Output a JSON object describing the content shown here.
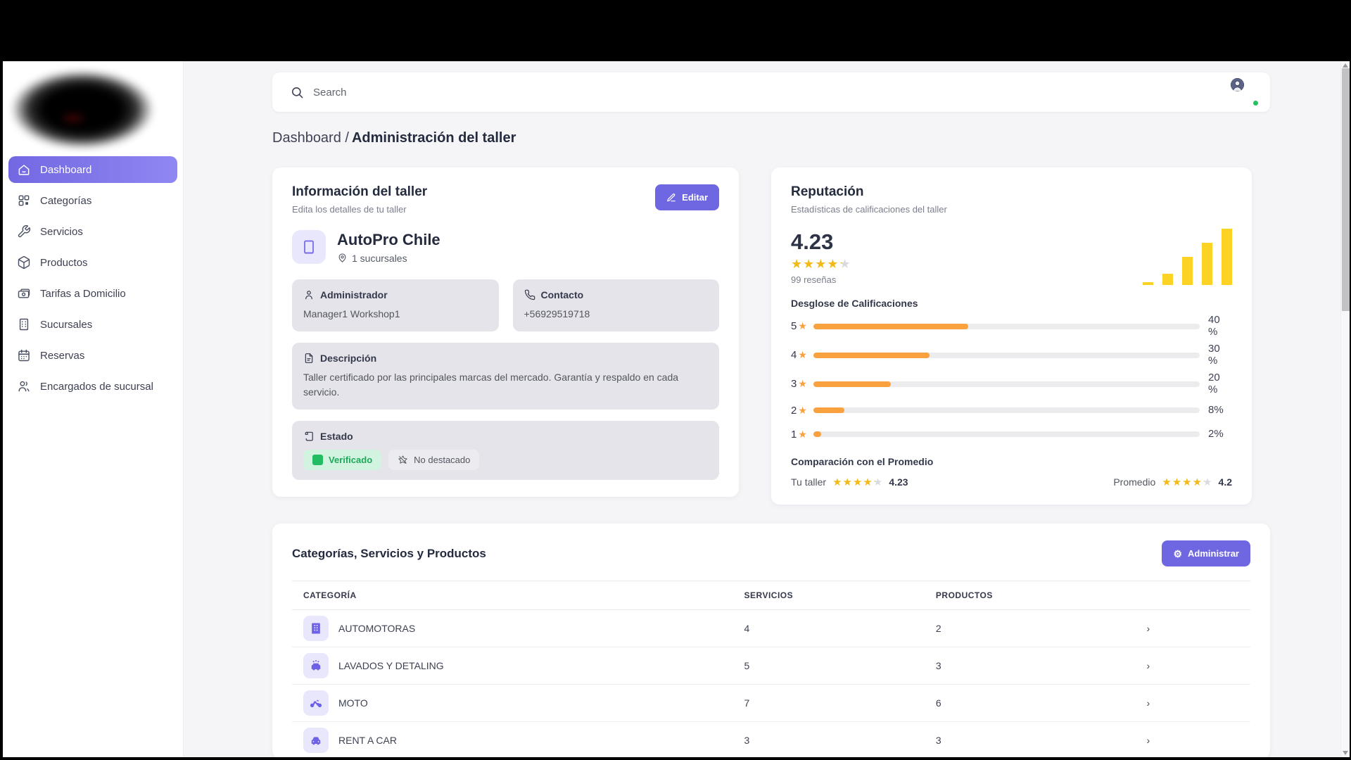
{
  "colors": {
    "accent": "#6f66e2",
    "gold": "#f3ba17",
    "bar_yellow": "#fcd325",
    "orange": "#f9a03f",
    "green": "#22bd63"
  },
  "topbar": {
    "search_placeholder": "Search"
  },
  "breadcrumb": {
    "parent": "Dashboard /",
    "current": "Administración del taller"
  },
  "sidebar": {
    "items": [
      {
        "label": "Dashboard",
        "active": true
      },
      {
        "label": "Categorías"
      },
      {
        "label": "Servicios"
      },
      {
        "label": "Productos"
      },
      {
        "label": "Tarifas a Domicilio"
      },
      {
        "label": "Sucursales"
      },
      {
        "label": "Reservas"
      },
      {
        "label": "Encargados de sucursal"
      }
    ]
  },
  "workshop_card": {
    "title": "Información del taller",
    "subtitle": "Edita los detalles de tu taller",
    "edit_button": "Editar",
    "name": "AutoPro Chile",
    "branches": "1 sucursales",
    "admin_label": "Administrador",
    "admin_value": "Manager1 Workshop1",
    "contact_label": "Contacto",
    "contact_value": "+56929519718",
    "description_label": "Descripción",
    "description_text": "Taller certificado por las principales marcas del mercado. Garantía y respaldo en cada servicio.",
    "status_label": "Estado",
    "verified_badge": "Verificado",
    "not_featured_badge": "No destacado"
  },
  "reputation_card": {
    "title": "Reputación",
    "subtitle": "Estadísticas de calificaciones del taller",
    "rating": "4.23",
    "rating_value": 4.23,
    "reviews": "99 reseñas",
    "mini_bars": [
      2,
      8,
      20,
      30,
      40
    ],
    "breakdown_title": "Desglose de Calificaciones",
    "breakdown": [
      {
        "stars": "5",
        "pct": 40,
        "label": "40 %"
      },
      {
        "stars": "4",
        "pct": 30,
        "label": "30 %"
      },
      {
        "stars": "3",
        "pct": 20,
        "label": "20 %"
      },
      {
        "stars": "2",
        "pct": 8,
        "label": "8%"
      },
      {
        "stars": "1",
        "pct": 2,
        "label": "2%"
      }
    ],
    "comparison_title": "Comparación con el Promedio",
    "your_label": "Tu taller",
    "your_value": "4.23",
    "your_rating": 4.23,
    "avg_label": "Promedio",
    "avg_value": "4.2",
    "avg_rating": 4.2
  },
  "catalog_card": {
    "title": "Categorías, Servicios y Productos",
    "manage_button": "Administrar",
    "columns": {
      "category": "CATEGORÍA",
      "services": "SERVICIOS",
      "products": "PRODUCTOS"
    },
    "rows": [
      {
        "name": "AUTOMOTORAS",
        "services": "4",
        "products": "2"
      },
      {
        "name": "LAVADOS Y DETALING",
        "services": "5",
        "products": "3"
      },
      {
        "name": "MOTO",
        "services": "7",
        "products": "6"
      },
      {
        "name": "RENT A CAR",
        "services": "3",
        "products": "3"
      }
    ]
  }
}
